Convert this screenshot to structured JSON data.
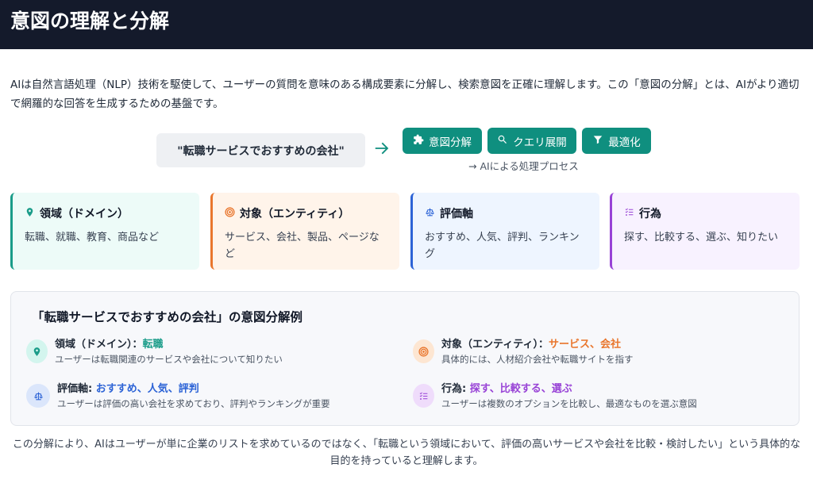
{
  "header": {
    "title": "意図の理解と分解"
  },
  "intro": {
    "text": "AIは自然言語処理（NLP）技術を駆使して、ユーザーの質問を意味のある構成要素に分解し、検索意図を正確に理解します。この「意図の分解」とは、AIがより適切で網羅的な回答を生成するための基盤です。"
  },
  "flow": {
    "query": "\"転職サービスでおすすめの会社\"",
    "arrow_icon": "arrow-right-icon",
    "steps": [
      {
        "label": "意図分解",
        "icon": "puzzle-icon"
      },
      {
        "label": "クエリ展開",
        "icon": "search-icon"
      },
      {
        "label": "最適化",
        "icon": "filter-icon"
      }
    ],
    "note": "→ AIによる処理プロセス"
  },
  "cards": [
    {
      "title": "領域（ドメイン）",
      "body": "転職、就職、教育、商品など",
      "icon": "map-marker-icon",
      "color": "#1a9c89"
    },
    {
      "title": "対象（エンティティ）",
      "body": "サービス、会社、製品、ページなど",
      "icon": "bullseye-icon",
      "color": "#e9762d"
    },
    {
      "title": "評価軸",
      "body": "おすすめ、人気、評判、ランキング",
      "icon": "balance-scale-icon",
      "color": "#2c63d6"
    },
    {
      "title": "行為",
      "body": "探す、比較する、選ぶ、知りたい",
      "icon": "task-list-icon",
      "color": "#9842d6"
    }
  ],
  "example": {
    "title": "「転職サービスでおすすめの会社」の意図分解例",
    "items": [
      {
        "label": "領域（ドメイン）：",
        "value": "転職",
        "desc": "ユーザーは転職関連のサービスや会社について知りたい",
        "color": "#1a9c89"
      },
      {
        "label": "対象（エンティティ）：",
        "value": "サービス、会社",
        "desc": "具体的には、人材紹介会社や転職サイトを指す",
        "color": "#e9762d"
      },
      {
        "label": "評価軸: ",
        "value": "おすすめ、人気、評判",
        "desc": "ユーザーは評価の高い会社を求めており、評判やランキングが重要",
        "color": "#2c63d6"
      },
      {
        "label": "行為: ",
        "value": "探す、比較する、選ぶ",
        "desc": "ユーザーは複数のオプションを比較し、最適なものを選ぶ意図",
        "color": "#9842d6"
      }
    ]
  },
  "summary": {
    "text": "この分解により、AIはユーザーが単に企業のリストを求めているのではなく、「転職という領域において、評価の高いサービスや会社を比較・検討したい」という具体的な目的を持っていると理解します。"
  }
}
